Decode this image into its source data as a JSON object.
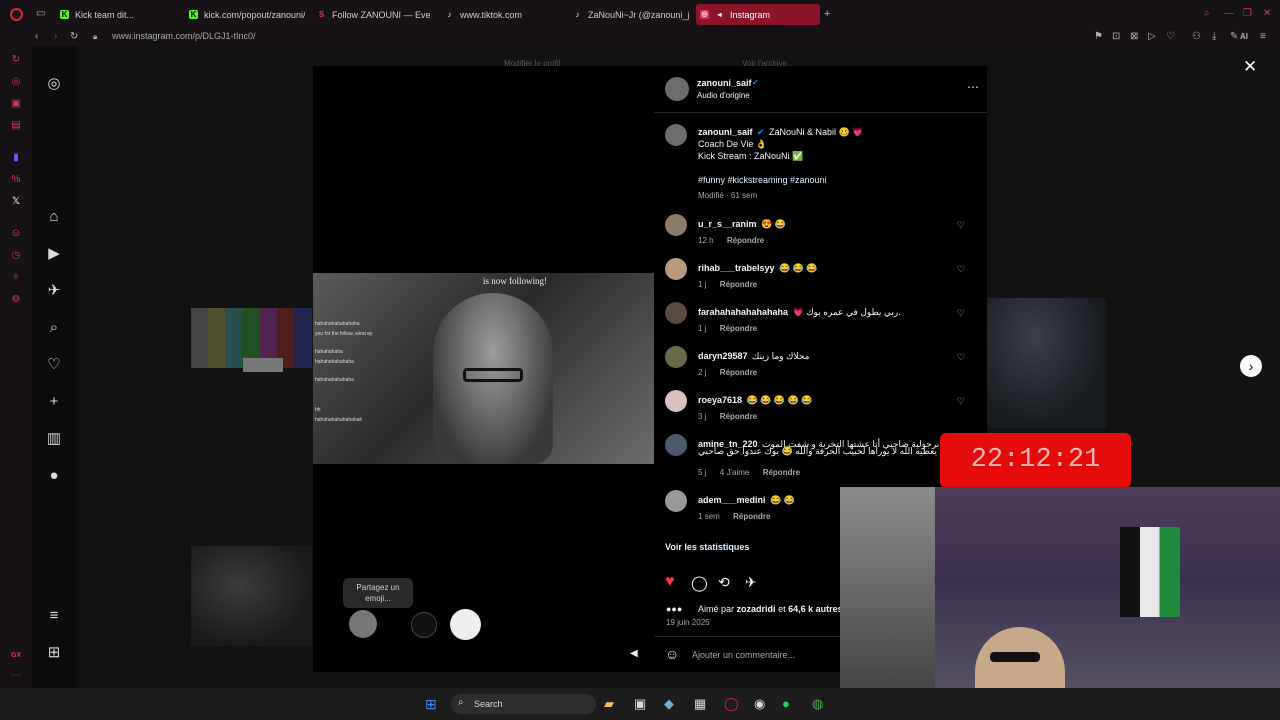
{
  "tabs": [
    {
      "label": "Kick team dit...",
      "fav_color": "#53fc18",
      "fav_glyph": "K"
    },
    {
      "label": "kick.com/popout/zanouni/",
      "fav_color": "#53fc18",
      "fav_glyph": "K"
    },
    {
      "label": "Follow ZANOUNI — Every ",
      "fav_color": "#e03b3b",
      "fav_glyph": "S"
    },
    {
      "label": "www.tiktok.com",
      "fav_color": "#ffffff",
      "fav_glyph": "♪"
    },
    {
      "label": "ZaNouNi~Jr (@zanouni_jr)",
      "fav_color": "#ffffff",
      "fav_glyph": "♪"
    },
    {
      "label": "Instagram",
      "fav_color": "#e1306c",
      "fav_glyph": "◎"
    }
  ],
  "address": {
    "url": "www.instagram.com/p/DLGJ1-tInc0/"
  },
  "behind_tabs": [
    "Modifier le profil",
    "Voir l'archive"
  ],
  "video": {
    "overlay_follow": "is now following!",
    "chat_lines": [
      "hahahahahahahaha",
      "you for the follow, wirat ey",
      "hahahahaha",
      "hahahahahahaha",
      "hahahahahahaha",
      "hh",
      "hahahahahahahahah"
    ],
    "emoji_prompt": "Partagez un emoji..."
  },
  "post": {
    "author": "zanouni_saif",
    "audio": "Audio d'origine",
    "caption_user": "zanouni_saif",
    "caption_text": "ZaNouNi & Nabil 🥴 💗",
    "caption_line2": "Coach De Vie 👌",
    "caption_line3": "Kick Stream : ZaNouNi ✅",
    "hashtags": "#funny #kickstreaming #zanouni",
    "caption_meta": "Modifié · 61 sem",
    "comments": [
      {
        "user": "u_r_s__ranim",
        "text": "😍 😂",
        "time": "12 h",
        "reply": "Répondre",
        "likes": ""
      },
      {
        "user": "rihab___trabelsyy",
        "text": "😂 😂 😂",
        "time": "1 j",
        "reply": "Répondre",
        "likes": ""
      },
      {
        "user": "farahahahahahahaha",
        "text": "💗 ربي يطول في عمره بوك.",
        "time": "1 j",
        "reply": "Répondre",
        "likes": ""
      },
      {
        "user": "daryn29587",
        "text": "محلاك وما زينك",
        "time": "2 j",
        "reply": "Répondre",
        "likes": ""
      },
      {
        "user": "roeya7618",
        "text": "😂 😂 😂 😂 😂",
        "time": "3 j",
        "reply": "Répondre",
        "likes": ""
      },
      {
        "user": "amine_tn_220",
        "text": "برجولية صاحبي أنا عشتها التجربة و شفت الموت",
        "text2": "يعطيه الله لا يوراها لحبيب الحرفة والله 😂 بوك عندوا حق صاحبي",
        "time": "5 j",
        "reply": "Répondre",
        "likes": "4 J'aime"
      },
      {
        "user": "adem___medini",
        "text": "😂 😂",
        "time": "1 sem",
        "reply": "Répondre",
        "likes": ""
      }
    ],
    "insights": "Voir les statistiques",
    "liked_by_prefix": "Aimé par",
    "liked_by_user": "zozadridi",
    "liked_by_suffix": "et",
    "liked_by_count": "64,6 k autres",
    "date": "19 juin 2025",
    "add_comment_placeholder": "Ajouter un commentaire..."
  },
  "stream": {
    "timer": "22:12:21"
  },
  "taskbar": {
    "search": "Search"
  },
  "colors": {
    "accent": "#e0263f",
    "like": "#ff3040",
    "link": "#e0f1ff",
    "timer_bg": "#e60b0b"
  }
}
